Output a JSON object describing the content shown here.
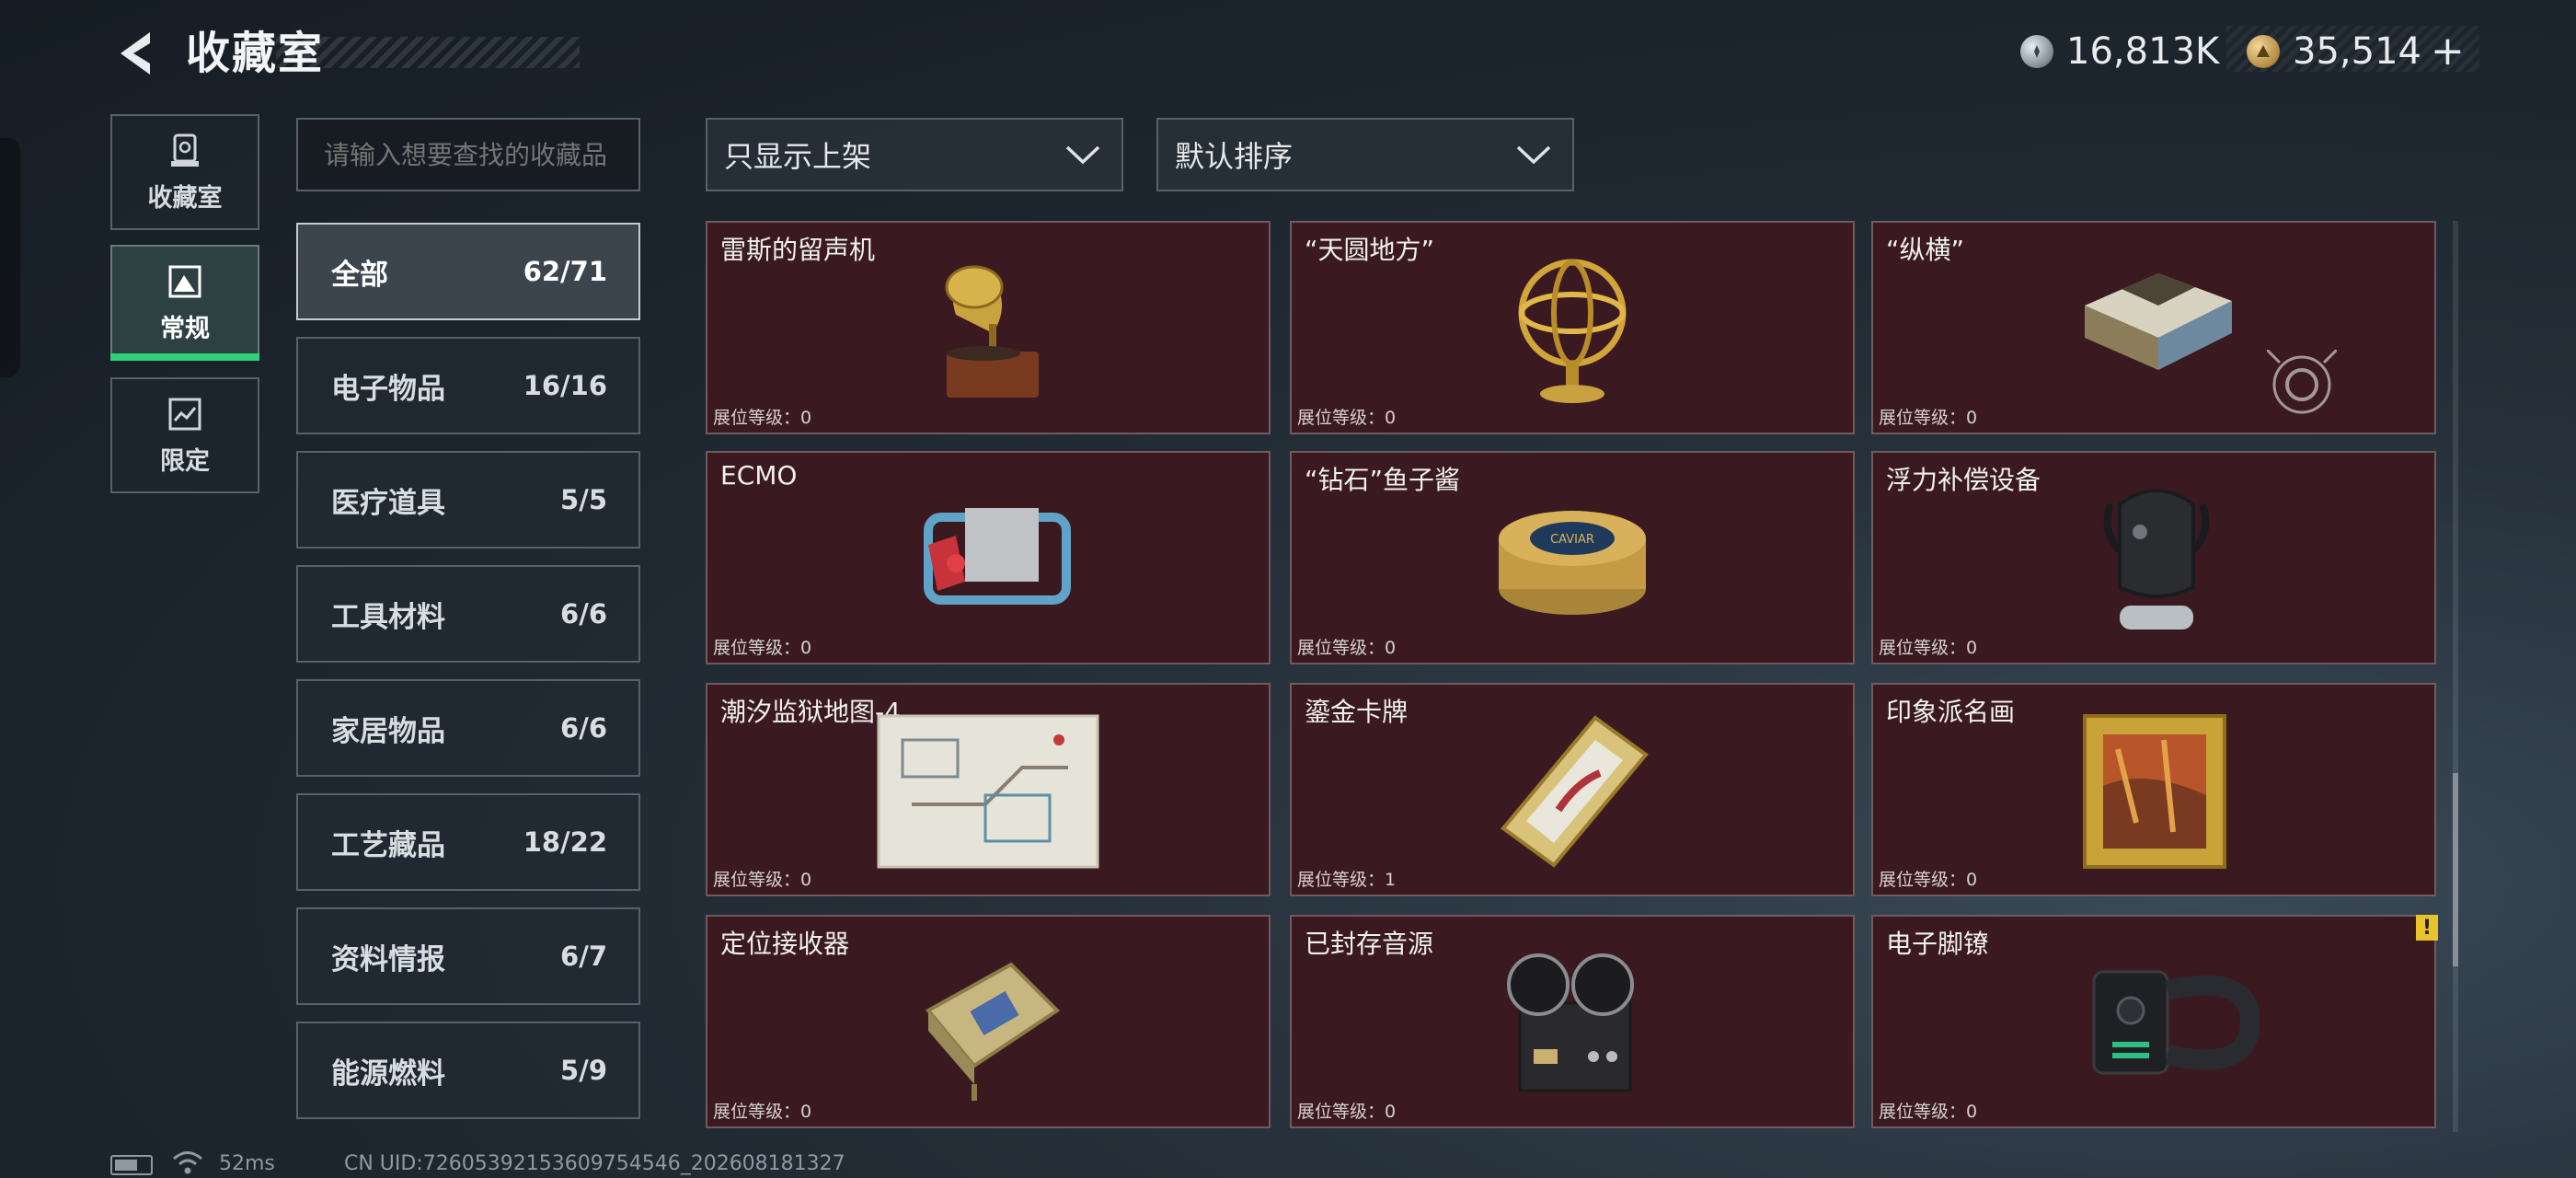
{
  "header": {
    "title": "收藏室",
    "currency_silver": "16,813K",
    "currency_gold": "35,514",
    "currency_plus": "+"
  },
  "nav": [
    {
      "label": "收藏室",
      "icon": "trophy-icon"
    },
    {
      "label": "常规",
      "icon": "landscape-icon",
      "active": true
    },
    {
      "label": "限定",
      "icon": "painting-icon"
    }
  ],
  "search": {
    "placeholder": "请输入想要查找的收藏品"
  },
  "categories": [
    {
      "name": "全部",
      "count": "62/71",
      "active": true
    },
    {
      "name": "电子物品",
      "count": "16/16"
    },
    {
      "name": "医疗道具",
      "count": "5/5"
    },
    {
      "name": "工具材料",
      "count": "6/6"
    },
    {
      "name": "家居物品",
      "count": "6/6"
    },
    {
      "name": "工艺藏品",
      "count": "18/22"
    },
    {
      "name": "资料情报",
      "count": "6/7"
    },
    {
      "name": "能源燃料",
      "count": "5/9"
    }
  ],
  "filters": {
    "shelf_filter": "只显示上架",
    "sort": "默认排序"
  },
  "items": [
    {
      "title": "雷斯的留声机",
      "level": "展位等级：0",
      "icon": "gramophone-icon"
    },
    {
      "title": "“天圆地方”",
      "level": "展位等级：0",
      "icon": "armillary-sphere-icon"
    },
    {
      "title": "“纵横”",
      "level": "展位等级：0",
      "icon": "chessboard-icon"
    },
    {
      "title": "ECMO",
      "level": "展位等级：0",
      "icon": "ecmo-machine-icon"
    },
    {
      "title": "“钻石”鱼子酱",
      "level": "展位等级：0",
      "icon": "caviar-tin-icon"
    },
    {
      "title": "浮力补偿设备",
      "level": "展位等级：0",
      "icon": "diving-bcd-icon"
    },
    {
      "title": "潮汐监狱地图-4",
      "level": "展位等级：0",
      "icon": "map-icon"
    },
    {
      "title": "鎏金卡牌",
      "level": "展位等级：1",
      "icon": "gilded-card-icon"
    },
    {
      "title": "印象派名画",
      "level": "展位等级：0",
      "icon": "framed-painting-icon"
    },
    {
      "title": "定位接收器",
      "level": "展位等级：0",
      "icon": "locator-receiver-icon"
    },
    {
      "title": "已封存音源",
      "level": "展位等级：0",
      "icon": "reel-recorder-icon"
    },
    {
      "title": "电子脚镣",
      "level": "展位等级：0",
      "icon": "ankle-monitor-icon"
    }
  ],
  "warning_badge": "!",
  "footer": {
    "ping": "52ms",
    "uid": "CN UID:72605392153609754546_202608181327"
  },
  "colors": {
    "active_green": "#2fd07a",
    "card_bg": "#3a1a20",
    "warning": "#e9c32e"
  }
}
